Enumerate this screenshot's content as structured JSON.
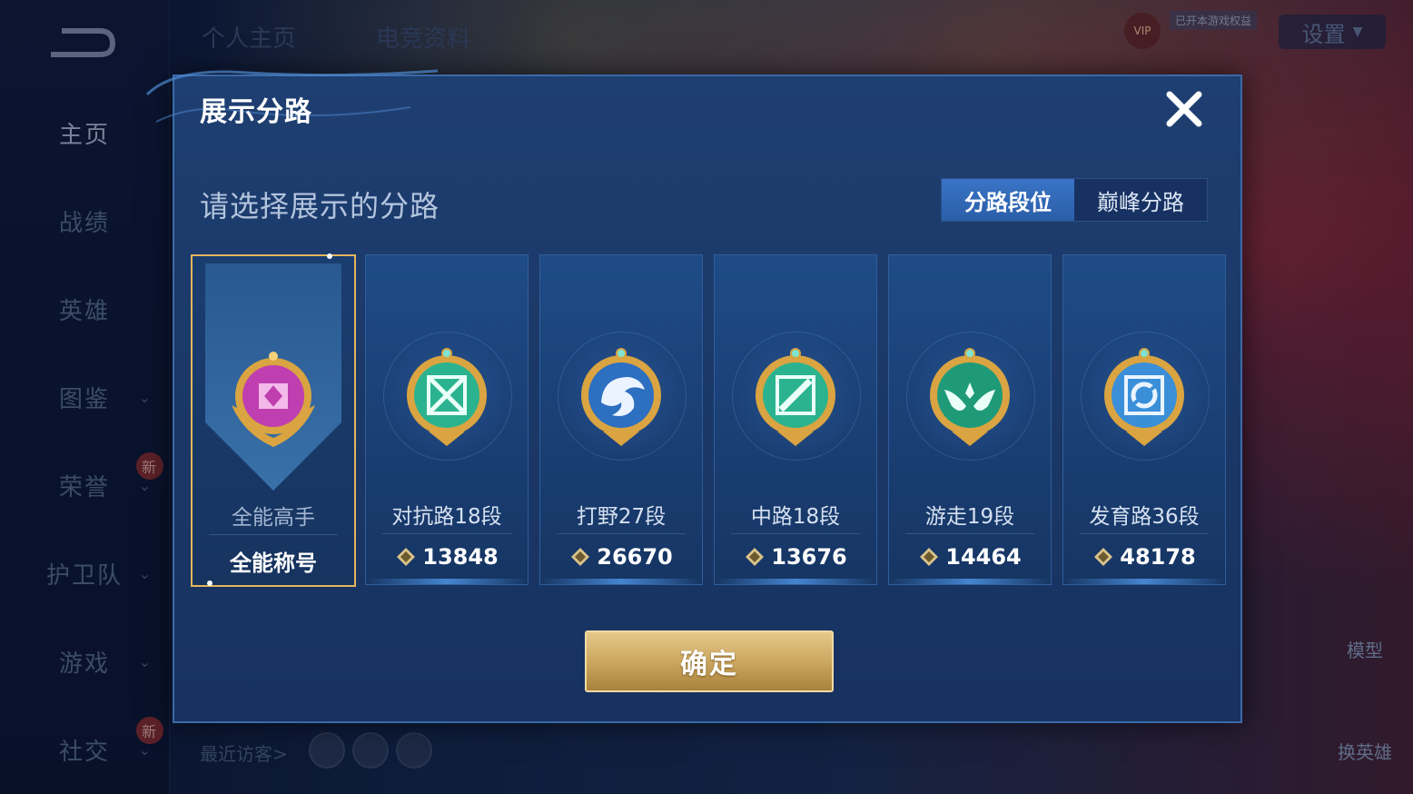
{
  "sidebar": {
    "items": [
      {
        "label": "主页",
        "active": true
      },
      {
        "label": "战绩"
      },
      {
        "label": "英雄"
      },
      {
        "label": "图鉴",
        "chevron": true
      },
      {
        "label": "荣誉",
        "chevron": true,
        "new": "新"
      },
      {
        "label": "护卫队",
        "chevron": true
      },
      {
        "label": "游戏",
        "chevron": true
      },
      {
        "label": "社交",
        "chevron": true,
        "new": "新"
      }
    ]
  },
  "top_nav": {
    "tab1": "个人主页",
    "tab2": "电竞资料",
    "settings": "设置",
    "vip": "VIP",
    "vip_note": "已开本游戏权益"
  },
  "right_buttons": {
    "model": "模型",
    "swap_hero": "换英雄"
  },
  "visitors": {
    "label": "最近访客>"
  },
  "modal": {
    "title": "展示分路",
    "subtitle": "请选择展示的分路",
    "toggle": {
      "option1": "分路段位",
      "option2": "巅峰分路",
      "selected": "分路段位"
    },
    "cards": [
      {
        "name": "全能高手",
        "value": "全能称号",
        "icon": "versatile-badge-icon",
        "color": "#c03fb0",
        "selected": true
      },
      {
        "name": "对抗路18段",
        "value": "13848",
        "icon": "clash-lane-badge-icon",
        "color": "#2bb38f"
      },
      {
        "name": "打野27段",
        "value": "26670",
        "icon": "jungle-badge-icon",
        "color": "#2d6fc0"
      },
      {
        "name": "中路18段",
        "value": "13676",
        "icon": "mid-lane-badge-icon",
        "color": "#2bb38f"
      },
      {
        "name": "游走19段",
        "value": "14464",
        "icon": "roam-badge-icon",
        "color": "#1f9a78"
      },
      {
        "name": "发育路36段",
        "value": "48178",
        "icon": "farm-lane-badge-icon",
        "color": "#3a8fd8"
      }
    ],
    "confirm": "确定"
  },
  "colors": {
    "accent": "#e4b65c",
    "modal_bg": "#1e3f72",
    "toggle_on": "#3a74c6"
  }
}
